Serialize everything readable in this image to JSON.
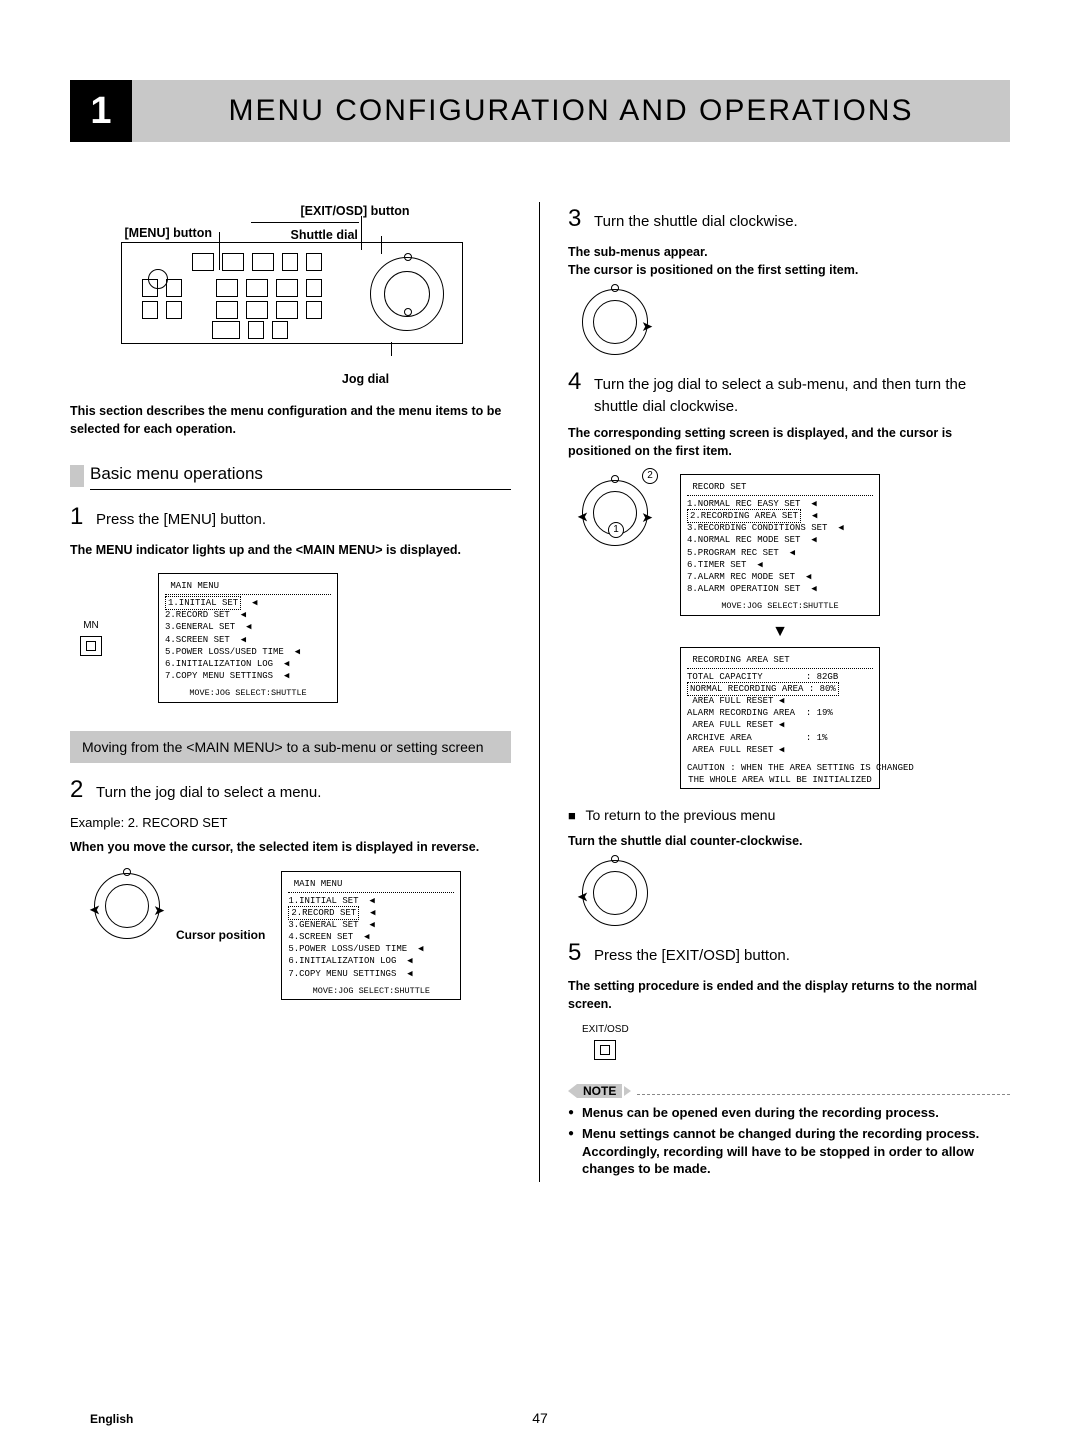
{
  "chapter": {
    "num": "1",
    "title": "MENU CONFIGURATION AND OPERATIONS"
  },
  "device_labels": {
    "menu_btn": "[MENU] button",
    "exit_btn": "[EXIT/OSD] button",
    "shuttle": "Shuttle dial",
    "jog": "Jog dial"
  },
  "left": {
    "describes": "This section describes the menu configuration and the menu items to be selected for each operation.",
    "section_title": "Basic menu operations",
    "step1_text": "Press the [MENU] button.",
    "step1_sub": "The MENU indicator lights up and the <MAIN MENU> is displayed.",
    "mn_label": "MN",
    "submenu_transition": "Moving from the <MAIN MENU> to a sub-menu or setting screen",
    "step2_text": "Turn the jog dial to select a menu.",
    "step2_note1": "Example: 2. RECORD SET",
    "step2_note2": "When you move the cursor, the selected item is displayed in reverse.",
    "cursor_label": "Cursor position"
  },
  "right": {
    "step3_text": "Turn the shuttle dial clockwise.",
    "step3_sub": "The sub-menus appear.\nThe cursor is positioned on the first setting item.",
    "step4_text": "Turn the jog dial to select a sub-menu, and then turn the shuttle dial clockwise.",
    "step4_sub": "The corresponding setting screen is displayed, and the cursor is positioned on the first item.",
    "return_line": "To return to the previous menu",
    "return_sub": "Turn the shuttle dial counter-clockwise.",
    "step5_text": "Press the [EXIT/OSD] button.",
    "step5_sub": "The setting procedure is ended and the display returns to the normal screen.",
    "exit_label": "EXIT/OSD",
    "note_label": "NOTE",
    "notes": [
      "Menus can be opened even during the recording process.",
      "Menu settings cannot be changed during the recording process. Accordingly, recording will have to be stopped in order to allow changes to be made."
    ]
  },
  "osd_main": {
    "title": "MAIN MENU",
    "items": [
      "1.INITIAL SET",
      "2.RECORD SET",
      "3.GENERAL SET",
      "4.SCREEN SET",
      "5.POWER LOSS/USED TIME",
      "6.INITIALIZATION LOG",
      "7.COPY MENU SETTINGS"
    ],
    "hint": "MOVE:JOG   SELECT:SHUTTLE"
  },
  "osd_main_hilite_index": 0,
  "osd_main2_hilite_index": 1,
  "osd_record": {
    "title": "RECORD SET",
    "items": [
      "1.NORMAL REC EASY SET",
      "2.RECORDING AREA SET",
      "3.RECORDING CONDITIONS SET",
      "4.NORMAL REC MODE SET",
      "5.PROGRAM REC SET",
      "6.TIMER SET",
      "7.ALARM REC MODE SET",
      "8.ALARM OPERATION SET"
    ],
    "hint": "MOVE:JOG   SELECT:SHUTTLE",
    "hilite_index": 1
  },
  "osd_area": {
    "title": "RECORDING AREA SET",
    "lines": [
      "TOTAL CAPACITY        : 82GB",
      "NORMAL RECORDING AREA : 80%",
      " AREA FULL RESET ◀",
      "ALARM RECORDING AREA  : 19%",
      " AREA FULL RESET ◀",
      "ARCHIVE AREA          : 1%",
      " AREA FULL RESET ◀"
    ],
    "caution": [
      "CAUTION : WHEN THE AREA SETTING IS CHANGED",
      "THE WHOLE AREA WILL BE INITIALIZED"
    ],
    "hilite_index": 1
  },
  "page_number": "47",
  "lang": "English"
}
